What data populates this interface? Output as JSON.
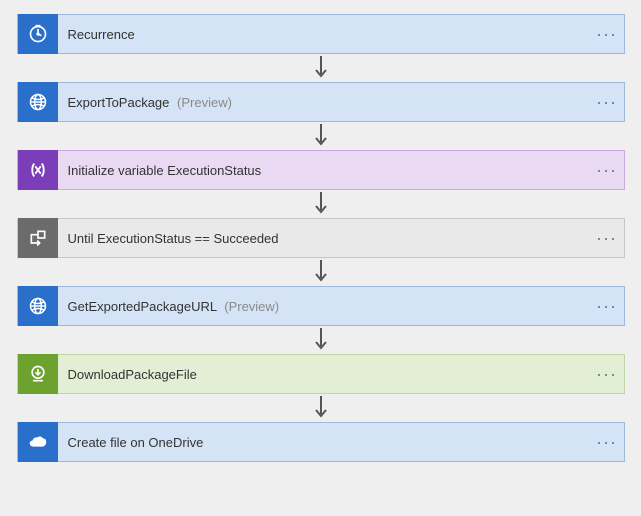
{
  "steps": [
    {
      "label": "Recurrence",
      "badge": "",
      "theme": "t-blue",
      "icon": "clock-icon"
    },
    {
      "label": "ExportToPackage",
      "badge": "(Preview)",
      "theme": "t-blue",
      "icon": "globe-icon"
    },
    {
      "label": "Initialize variable ExecutionStatus",
      "badge": "",
      "theme": "t-purple",
      "icon": "variable-icon"
    },
    {
      "label": "Until ExecutionStatus == Succeeded",
      "badge": "",
      "theme": "t-gray",
      "icon": "loop-icon"
    },
    {
      "label": "GetExportedPackageURL",
      "badge": "(Preview)",
      "theme": "t-blue",
      "icon": "globe-icon"
    },
    {
      "label": "DownloadPackageFile",
      "badge": "",
      "theme": "t-green",
      "icon": "download-icon"
    },
    {
      "label": "Create file on OneDrive",
      "badge": "",
      "theme": "t-blue",
      "icon": "onedrive-icon"
    }
  ],
  "menu_glyph": "···"
}
